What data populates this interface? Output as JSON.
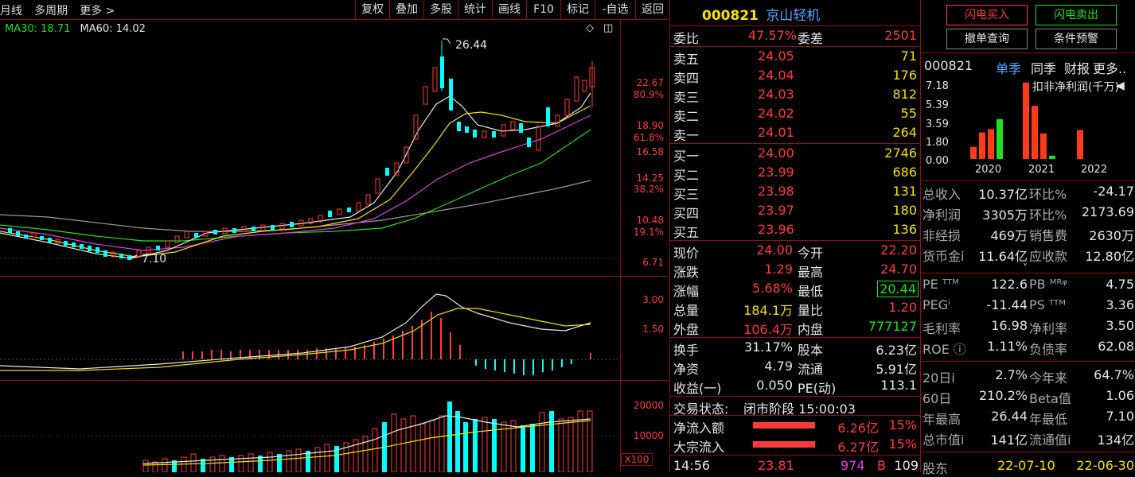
{
  "toolbar": {
    "left_items": [
      "月线",
      "多周期",
      "更多 >"
    ],
    "buttons": [
      "复权",
      "叠加",
      "多股",
      "统计",
      "画线",
      "F10",
      "标记",
      "-自选",
      "返回"
    ]
  },
  "ma_legend": {
    "ma30": "MA30: 18.71",
    "ma60": "MA60: 14.02"
  },
  "main_chart": {
    "high_label": "26.44",
    "low_label": "7.10",
    "price_axis": [
      "22.67",
      "80.9%",
      "18.90",
      "61.8%",
      "16.58",
      "14.25",
      "38.2%",
      "10.48",
      "19.1%",
      "6.71"
    ]
  },
  "macd_axis": [
    "3.00",
    "1.50"
  ],
  "volume_axis": [
    "20000",
    "10000",
    "X100"
  ],
  "stock": {
    "code": "000821",
    "name": "京山轻机"
  },
  "orderbook": {
    "weibi": {
      "label": "委比",
      "value": "47.57%",
      "diff_label": "委差",
      "diff": "2501"
    },
    "sells": [
      {
        "label": "卖五",
        "price": "24.05",
        "vol": "71"
      },
      {
        "label": "卖四",
        "price": "24.04",
        "vol": "176"
      },
      {
        "label": "卖三",
        "price": "24.03",
        "vol": "812"
      },
      {
        "label": "卖二",
        "price": "24.02",
        "vol": "55"
      },
      {
        "label": "卖一",
        "price": "24.01",
        "vol": "264"
      }
    ],
    "buys": [
      {
        "label": "买一",
        "price": "24.00",
        "vol": "2746"
      },
      {
        "label": "买二",
        "price": "23.99",
        "vol": "686"
      },
      {
        "label": "买三",
        "price": "23.98",
        "vol": "131"
      },
      {
        "label": "买四",
        "price": "23.97",
        "vol": "180"
      },
      {
        "label": "买五",
        "price": "23.96",
        "vol": "136"
      }
    ]
  },
  "quote": [
    {
      "l1": "现价",
      "v1": "24.00",
      "c1": "red",
      "l2": "今开",
      "v2": "22.20",
      "c2": "red"
    },
    {
      "l1": "涨跌",
      "v1": "1.29",
      "c1": "red",
      "l2": "最高",
      "v2": "24.70",
      "c2": "red"
    },
    {
      "l1": "涨幅",
      "v1": "5.68%",
      "c1": "red",
      "l2": "最低",
      "v2": "20.44",
      "c2": "green"
    },
    {
      "l1": "总量",
      "v1": "184.1万",
      "c1": "yellow",
      "l2": "量比",
      "v2": "1.20",
      "c2": "red"
    },
    {
      "l1": "外盘",
      "v1": "106.4万",
      "c1": "red",
      "l2": "内盘",
      "v2": "777127",
      "c2": "green"
    }
  ],
  "fundamentals": [
    {
      "l1": "换手",
      "v1": "31.17%",
      "l2": "股本",
      "v2": "6.23亿"
    },
    {
      "l1": "净资",
      "v1": "4.79",
      "l2": "流通",
      "v2": "5.91亿"
    },
    {
      "l1": "收益(一)",
      "v1": "0.050",
      "l2": "PE(动)",
      "v2": "113.1"
    }
  ],
  "trade_status": {
    "label": "交易状态:",
    "value": "闭市阶段 15:00:03"
  },
  "flows": [
    {
      "label": "净流入额",
      "amount": "6.26亿",
      "pct": "15%"
    },
    {
      "label": "大宗流入",
      "amount": "6.27亿",
      "pct": "15%"
    }
  ],
  "tick": {
    "time": "14:56",
    "price": "23.81",
    "vol": "974",
    "side": "B",
    "num": "109"
  },
  "actions": {
    "flash_buy": "闪电买入",
    "flash_sell": "闪电卖出",
    "cancel_query": "撤单查询",
    "cond_alert": "条件预警"
  },
  "fin_tabs": {
    "code": "000821",
    "tabs": [
      "单季",
      "同季",
      "财报",
      "更多.."
    ]
  },
  "fin_chart": {
    "title": "扣非净利润(千万)",
    "y_ticks": [
      "7.18",
      "5.39",
      "3.59",
      "1.80",
      "0.00"
    ],
    "years": [
      "2020",
      "2021",
      "2022"
    ]
  },
  "chart_data": {
    "type": "bar",
    "title": "扣非净利润(千万)",
    "categories": [
      "2020Q1",
      "2020Q2",
      "2020Q3",
      "2020Q4",
      "2021Q1",
      "2021Q2",
      "2021Q3",
      "2021Q4",
      "2022Q1"
    ],
    "values": [
      1.1,
      2.4,
      2.7,
      3.6,
      6.9,
      4.8,
      2.3,
      0.3,
      2.6
    ],
    "colors": [
      "#ff3b1a",
      "#ff3b1a",
      "#ff3b1a",
      "#20e020",
      "#ff3b1a",
      "#ff3b1a",
      "#ff3b1a",
      "#20e020",
      "#ff3b1a"
    ],
    "ylim": [
      0,
      7.18
    ]
  },
  "fin_table": [
    {
      "l1": "总收入",
      "v1": "10.37亿",
      "l2": "环比%",
      "v2": "-24.17"
    },
    {
      "l1": "净利润",
      "v1": "3305万",
      "l2": "环比%",
      "v2": "2173.69"
    },
    {
      "l1": "非经损",
      "v1": "469万",
      "l2": "销售费",
      "v2": "2630万"
    },
    {
      "l1": "货币金i",
      "v1": "11.64亿",
      "l2": "应收款",
      "v2": "12.80亿"
    }
  ],
  "valuation": [
    {
      "l1": "PE ᵀᵀᴹ",
      "v1": "122.6",
      "l2": "PB ᴹᴿᵠ",
      "v2": "4.75"
    },
    {
      "l1": "PEGⁱ",
      "v1": "-11.44",
      "l2": "PS ᵀᵀᴹ",
      "v2": "3.36"
    },
    {
      "l1": "毛利率",
      "v1": "16.98",
      "l2": "净利率",
      "v2": "3.50"
    },
    {
      "l1": "ROE ⓘ",
      "v1": "1.11%",
      "l2": "负债率",
      "v2": "62.08"
    }
  ],
  "performance": [
    {
      "l1": "20日i",
      "v1": "2.7%",
      "l2": "今年来",
      "v2": "64.7%"
    },
    {
      "l1": "60日",
      "v1": "210.2%",
      "l2": "Beta值",
      "v2": "1.06"
    },
    {
      "l1": "年最高",
      "v1": "26.44",
      "l2": "年最低",
      "v2": "7.10"
    },
    {
      "l1": "总市值i",
      "v1": "141亿",
      "l2": "流通值i",
      "v2": "134亿"
    }
  ],
  "bottom_row": {
    "label": "股东",
    "d1": "22-07-10",
    "d2": "22-06-30"
  },
  "colors": {
    "up": "#ff3b3b",
    "down": "#00ffff",
    "grid": "#8b1010",
    "ma_white": "#e6e6e6",
    "ma_yellow": "#f5e000",
    "ma_magenta": "#e040e0",
    "ma_green": "#20e020",
    "ma_gray": "#999999"
  }
}
